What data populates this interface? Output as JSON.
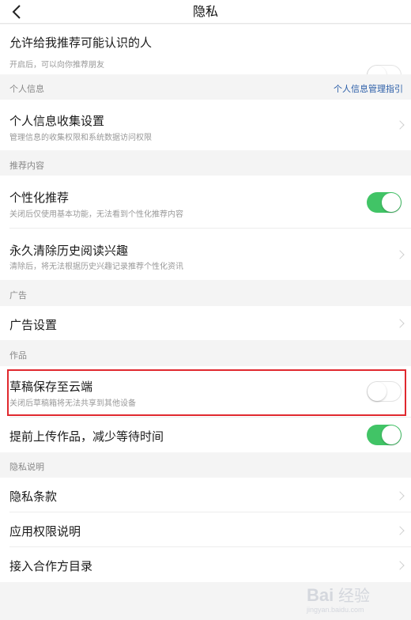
{
  "header": {
    "title": "隐私",
    "back_icon": "back-arrow-icon"
  },
  "rows": {
    "recommend_people": {
      "label": "允许给我推荐可能认识的人",
      "sub": "开启后，可以向你推荐朋友",
      "toggle": "off"
    },
    "personal_info_collect": {
      "label": "个人信息收集设置",
      "sub": "管理信息的收集权限和系统数据访问权限"
    },
    "personalized": {
      "label": "个性化推荐",
      "sub": "关闭后仅使用基本功能，无法看到个性化推荐内容",
      "toggle": "on"
    },
    "clear_history": {
      "label": "永久清除历史阅读兴趣",
      "sub": "清除后，将无法根据历史兴趣记录推荐个性化资讯"
    },
    "ad_settings": {
      "label": "广告设置"
    },
    "draft_cloud": {
      "label": "草稿保存至云端",
      "sub": "关闭后草稿箱将无法共享到其他设备",
      "toggle": "off"
    },
    "pre_upload": {
      "label": "提前上传作品，减少等待时间",
      "toggle": "on"
    },
    "privacy_terms": {
      "label": "隐私条款"
    },
    "app_permissions": {
      "label": "应用权限说明"
    },
    "partner_list": {
      "label": "接入合作方目录"
    }
  },
  "sections": {
    "personal_info": {
      "title": "个人信息",
      "link": "个人信息管理指引"
    },
    "recommend_content": {
      "title": "推荐内容"
    },
    "ads": {
      "title": "广告"
    },
    "works": {
      "title": "作品"
    },
    "privacy_desc": {
      "title": "隐私说明"
    }
  },
  "colors": {
    "toggle_on": "#41c466",
    "link": "#2b5ea8",
    "highlight": "#e0282e"
  },
  "watermark": {
    "text": "Bai经验",
    "sub": "jingyan.baidu.com"
  }
}
